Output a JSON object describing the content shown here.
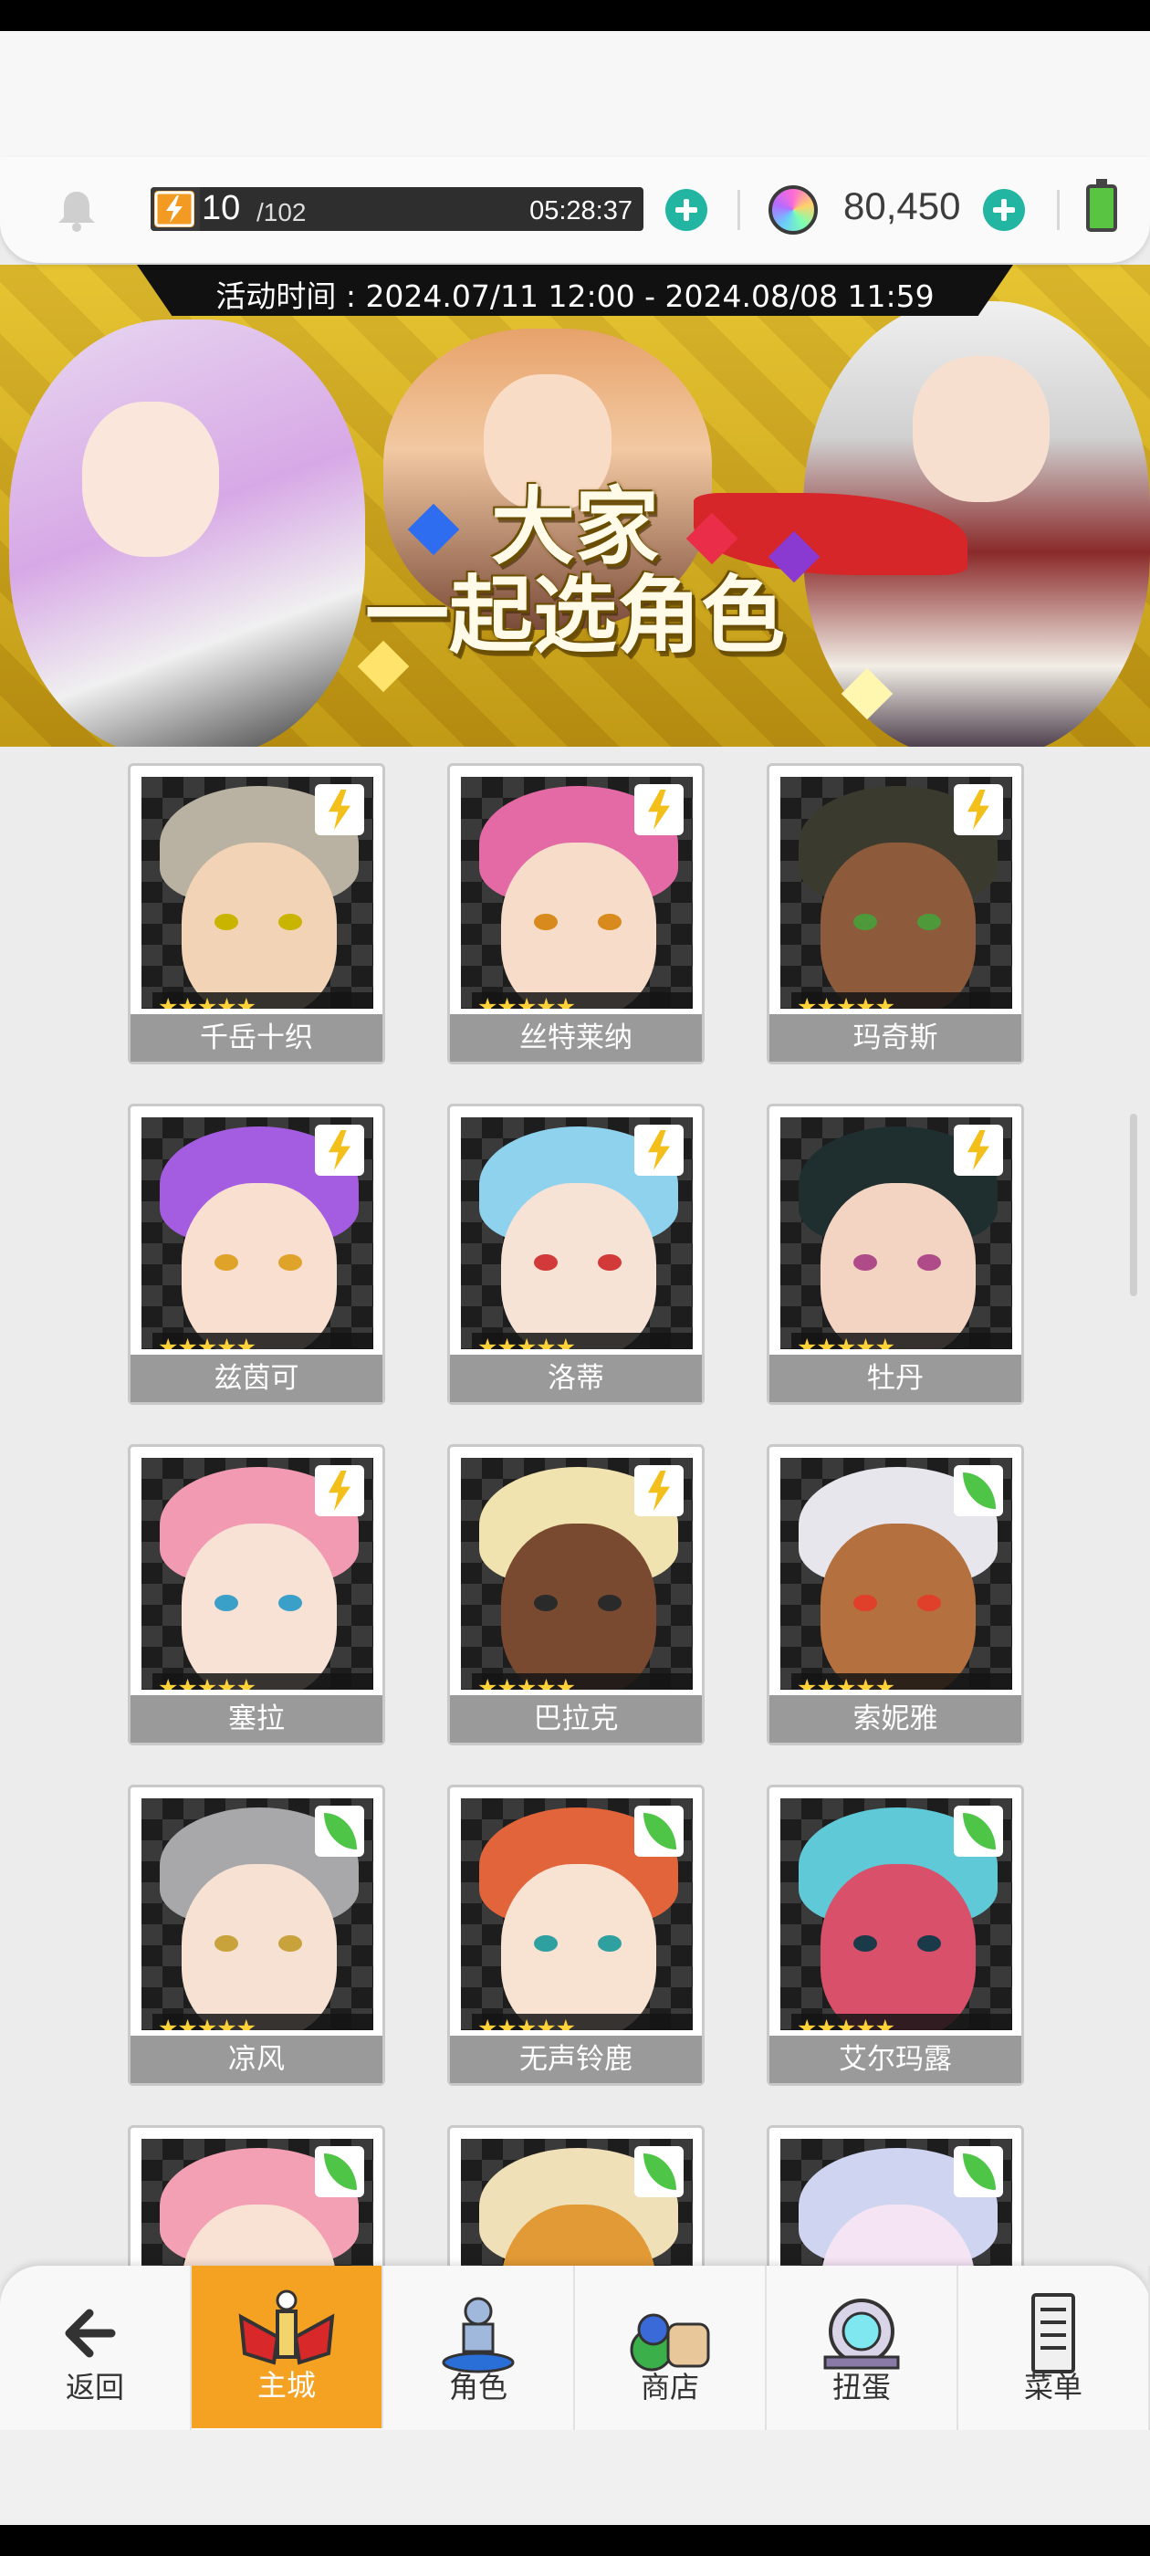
{
  "topbar": {
    "stamina_current": "10",
    "stamina_max": "/102",
    "stamina_timer": "05:28:37",
    "gems": "80,450"
  },
  "banner": {
    "event_time": "活动时间 : 2024.07/11 12:00 - 2024.08/08 11:59",
    "title_line1": "大家",
    "title_line2": "一起选角色"
  },
  "characters": [
    {
      "name": "千岳十织",
      "stars": "★★★★★",
      "attribute": "lightning",
      "hair": "#b9b2a2",
      "skin": "#f2d3b6",
      "eye": "#c9b400"
    },
    {
      "name": "丝特莱纳",
      "stars": "★★★★★",
      "attribute": "lightning",
      "hair": "#e36aa4",
      "skin": "#f6dcc9",
      "eye": "#d88a1c"
    },
    {
      "name": "玛奇斯",
      "stars": "★★★★★",
      "attribute": "lightning",
      "hair": "#3a3a2e",
      "skin": "#8d5a3c",
      "eye": "#4e9a3a"
    },
    {
      "name": "兹茵可",
      "stars": "★★★★★",
      "attribute": "lightning",
      "hair": "#a45de0",
      "skin": "#f8dfd0",
      "eye": "#e0a32a"
    },
    {
      "name": "洛蒂",
      "stars": "★★★★★",
      "attribute": "lightning",
      "hair": "#8fd2ee",
      "skin": "#f7e2d6",
      "eye": "#d23a3a"
    },
    {
      "name": "牡丹",
      "stars": "★★★★★",
      "attribute": "lightning",
      "hair": "#1f2f2f",
      "skin": "#f3d4c2",
      "eye": "#b04b8a"
    },
    {
      "name": "塞拉",
      "stars": "★★★★★",
      "attribute": "lightning",
      "hair": "#f29ab2",
      "skin": "#f8e2d6",
      "eye": "#3aa0c8"
    },
    {
      "name": "巴拉克",
      "stars": "★★★★★",
      "attribute": "lightning",
      "hair": "#f1e3b0",
      "skin": "#7a4a30",
      "eye": "#2a2a2a"
    },
    {
      "name": "索妮雅",
      "stars": "★★★★★",
      "attribute": "wind",
      "hair": "#e6e6ec",
      "skin": "#b5703f",
      "eye": "#e0402a"
    },
    {
      "name": "凉风",
      "stars": "★★★★★",
      "attribute": "wind",
      "hair": "#a8a8aa",
      "skin": "#f6e1d2",
      "eye": "#c8a23a"
    },
    {
      "name": "无声铃鹿",
      "stars": "★★★★★",
      "attribute": "wind",
      "hair": "#e2643a",
      "skin": "#f8e2d2",
      "eye": "#2ea0a0"
    },
    {
      "name": "艾尔玛露",
      "stars": "★★★★★",
      "attribute": "wind",
      "hair": "#5fc9d8",
      "skin": "#d8506a",
      "eye": "#1a3a4a"
    },
    {
      "name": "",
      "stars": "★★★★★",
      "attribute": "wind",
      "hair": "#f4a0b4",
      "skin": "#f9e2d4",
      "eye": "#d05070"
    },
    {
      "name": "",
      "stars": "★★★★★",
      "attribute": "wind",
      "hair": "#f0e0b8",
      "skin": "#e29a36",
      "eye": "#8a3a1a"
    },
    {
      "name": "",
      "stars": "★★★★★",
      "attribute": "wind",
      "hair": "#cfd4f0",
      "skin": "#f4e4f4",
      "eye": "#9050a0"
    }
  ],
  "nav": [
    {
      "label": "返回",
      "icon": "back-arrow-icon",
      "active": false
    },
    {
      "label": "主城",
      "icon": "castle-icon",
      "active": true
    },
    {
      "label": "角色",
      "icon": "character-icon",
      "active": false
    },
    {
      "label": "商店",
      "icon": "shop-icon",
      "active": false
    },
    {
      "label": "扭蛋",
      "icon": "gacha-icon",
      "active": false
    },
    {
      "label": "菜单",
      "icon": "menu-icon",
      "active": false
    }
  ],
  "colors": {
    "accent_teal": "#22b5a2",
    "active_tab": "#f5a223",
    "lightning": "#f3bf1b",
    "wind": "#4fc548"
  }
}
